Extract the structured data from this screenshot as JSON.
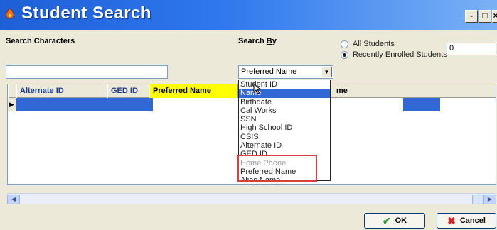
{
  "window": {
    "title": "Student Search",
    "minimize": "-",
    "maximize": "□",
    "close": "×"
  },
  "search": {
    "characters_label": "Search Characters",
    "characters_value": ""
  },
  "search_by": {
    "label_prefix": "Search ",
    "label_accel": "B",
    "label_suffix": "y",
    "selected": "Preferred Name",
    "options": [
      {
        "label": "Student ID",
        "state": "normal"
      },
      {
        "label": "Name",
        "state": "selected"
      },
      {
        "label": "Birthdate",
        "state": "normal"
      },
      {
        "label": "Cal Works",
        "state": "normal"
      },
      {
        "label": "SSN",
        "state": "normal"
      },
      {
        "label": "High School ID",
        "state": "normal"
      },
      {
        "label": "CSIS",
        "state": "normal"
      },
      {
        "label": "Alternate ID",
        "state": "normal"
      },
      {
        "label": "GED ID",
        "state": "normal"
      },
      {
        "label": "Home Phone",
        "state": "faded"
      },
      {
        "label": "Preferred Name",
        "state": "normal"
      },
      {
        "label": "Alias Name",
        "state": "normal"
      }
    ]
  },
  "scope": {
    "all_students": "All Students",
    "recently_enrolled": "Recently Enrolled Students",
    "recent_count": "0",
    "selected": "recently_enrolled"
  },
  "grid": {
    "columns": [
      "Alternate ID",
      "GED ID",
      "Preferred Name",
      "me"
    ]
  },
  "buttons": {
    "ok": "OK",
    "cancel": "Cancel"
  },
  "colors": {
    "title_bar": "#2f78ee",
    "selection": "#3168d5",
    "annotation": "#d8403a"
  }
}
